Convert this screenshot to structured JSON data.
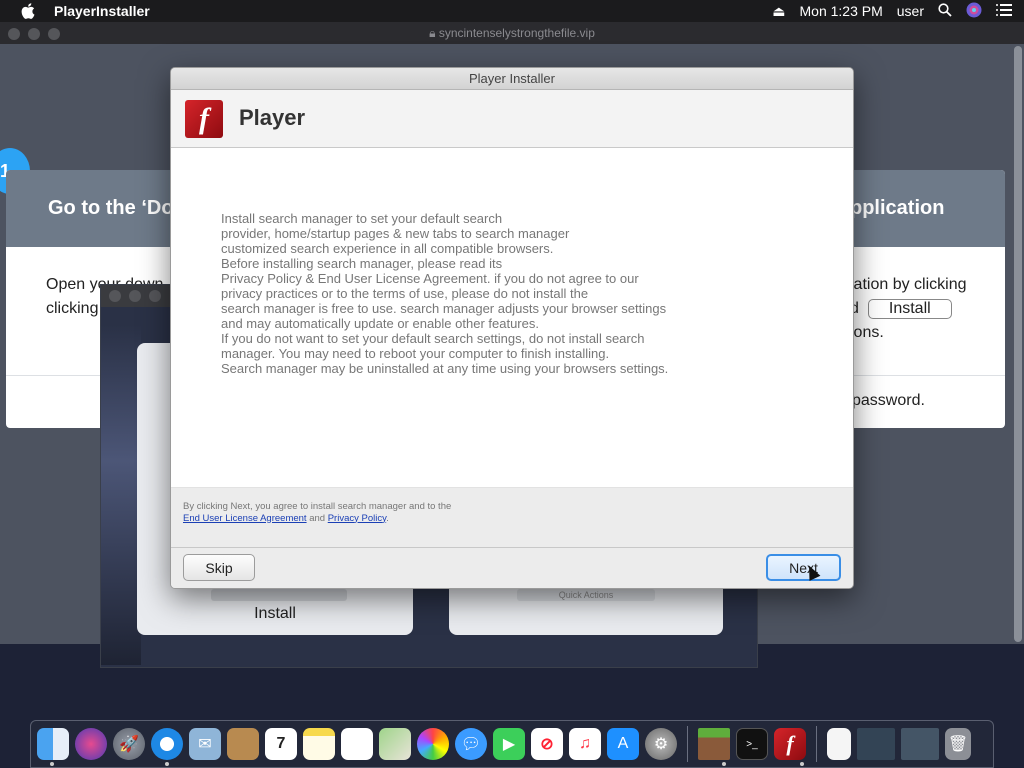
{
  "menubar": {
    "app_name": "PlayerInstaller",
    "clock": "Mon 1:23 PM",
    "user": "user"
  },
  "browser": {
    "url": "syncintenselystrongthefile.vip"
  },
  "background_page": {
    "step_number": "1",
    "left_heading": "Go to the ‘Do",
    "left_text_1": "Open your down",
    "left_text_2": "clicking",
    "right_heading": "pplication",
    "right_text_1": "lation by clicking",
    "right_text_2_pre": "d",
    "right_button": "Install",
    "right_text_3": "ions.",
    "right_password": "password.",
    "card_install_label": "Install",
    "card2_bar_label": "Quick Actions"
  },
  "dialog": {
    "window_title": "Player Installer",
    "product_title": "Player",
    "body_lines": [
      "Install search manager to set your default search",
      "provider, home/startup pages & new tabs to search manager",
      "customized search experience in all compatible browsers.",
      "Before installing search manager, please read its",
      "Privacy Policy & End User License Agreement. if you do not agree to our",
      "privacy practices or to the terms of use, please do not install the",
      "search manager is free to use. search manager adjusts your browser settings",
      "and may automatically update or enable other features.",
      "If you do not want to set your default search settings, do not install search",
      "manager. You may need to reboot your computer to finish installing.",
      "Search manager may be uninstalled at any time using your browsers settings."
    ],
    "agree_text": "By clicking Next, you agree to install search manager and to the",
    "eula_link": "End User License Agreement",
    "and_text": "and",
    "privacy_link": "Privacy Policy",
    "period": ".",
    "skip_label": "Skip",
    "next_label": "Next"
  },
  "dock": {
    "calendar_day": "7",
    "items": [
      "finder-icon",
      "siri-icon",
      "launchpad-icon",
      "safari-icon",
      "mail-icon",
      "notes-brown-icon",
      "calendar-icon",
      "notes-icon",
      "reminders-icon",
      "maps-icon",
      "photos-icon",
      "messages-icon",
      "facetime-icon",
      "news-icon",
      "music-icon",
      "app-store-icon",
      "system-preferences-icon",
      "minecraft-icon",
      "terminal-icon",
      "flash-player-icon",
      "document-icon",
      "screenshot-icon",
      "preview-icon",
      "trash-icon"
    ]
  },
  "colors": {
    "accent_blue": "#2ca3f4",
    "flash_red": "#d5242a",
    "link_blue": "#1a3fb5"
  }
}
